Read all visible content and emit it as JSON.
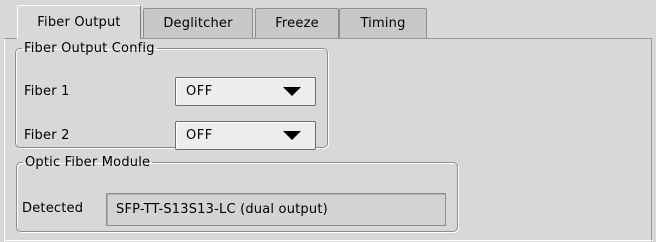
{
  "tabs": [
    {
      "label": "Fiber Output",
      "active": true
    },
    {
      "label": "Deglitcher",
      "active": false
    },
    {
      "label": "Freeze",
      "active": false
    },
    {
      "label": "Timing",
      "active": false
    }
  ],
  "fiber_output_config": {
    "title": "Fiber Output Config",
    "fiber1": {
      "label": "Fiber 1",
      "value": "OFF",
      "icon": "triangle-down-icon"
    },
    "fiber2": {
      "label": "Fiber 2",
      "value": "OFF",
      "icon": "triangle-down-icon"
    }
  },
  "optic_fiber_module": {
    "title": "Optic Fiber Module",
    "detected_label": "Detected",
    "detected_value": "SFP-TT-S13S13-LC (dual output)"
  },
  "colors": {
    "background": "#d8d8d8",
    "border": "#8c8c8c",
    "field_background": "#d3d3d3",
    "dropdown_background": "#ededed"
  }
}
